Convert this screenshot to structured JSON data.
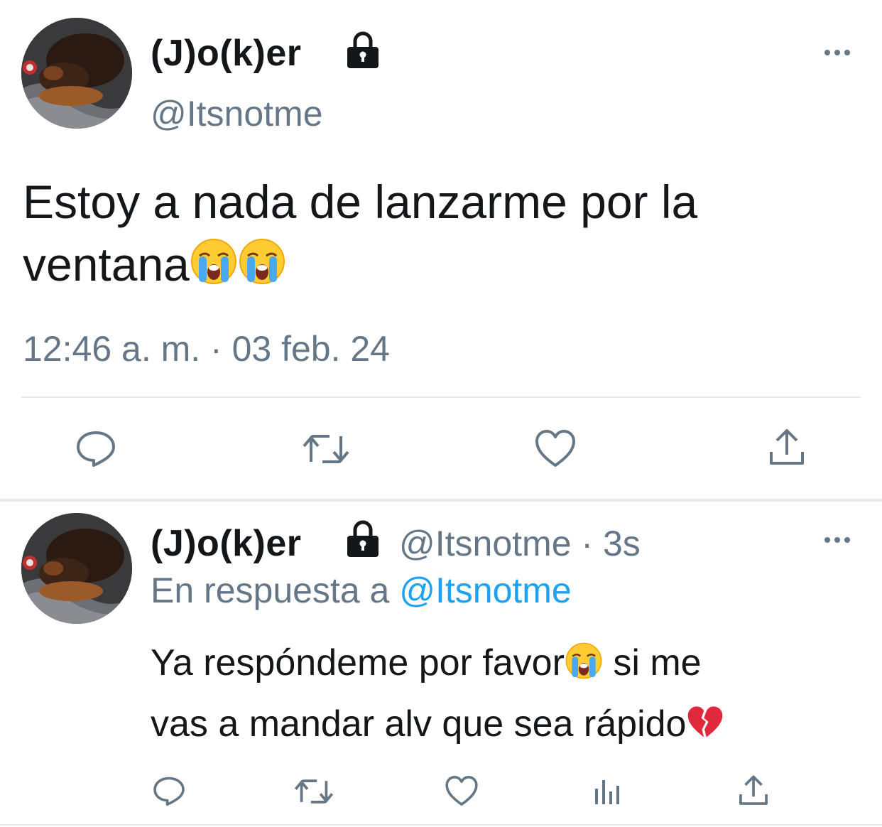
{
  "main_tweet": {
    "display_name": "(J)o(k)er",
    "handle": "@Itsnotme",
    "text_line1": "Estoy a nada de lanzarme por la",
    "text_line2": "ventana",
    "timestamp": "12:46 a. m. · 03 feb. 24",
    "icons": [
      "lock-icon",
      "more-icon",
      "reply-icon",
      "retweet-icon",
      "like-icon",
      "share-icon"
    ]
  },
  "reply_tweet": {
    "display_name": "(J)o(k)er",
    "handle_time": "@Itsnotme · 3s",
    "in_reply_prefix": "En respuesta a",
    "in_reply_handle": "@Itsnotme",
    "text_line1_a": "Ya respóndeme por favor",
    "text_line1_b": " si me",
    "text_line2": "vas a mandar alv que sea rápido",
    "icons": [
      "lock-icon",
      "more-icon",
      "reply-icon",
      "retweet-icon",
      "like-icon",
      "analytics-icon",
      "share-icon"
    ]
  },
  "colors": {
    "text": "#14171a",
    "muted": "#657786",
    "link": "#1da1f2",
    "divider": "#e6ecf0"
  }
}
